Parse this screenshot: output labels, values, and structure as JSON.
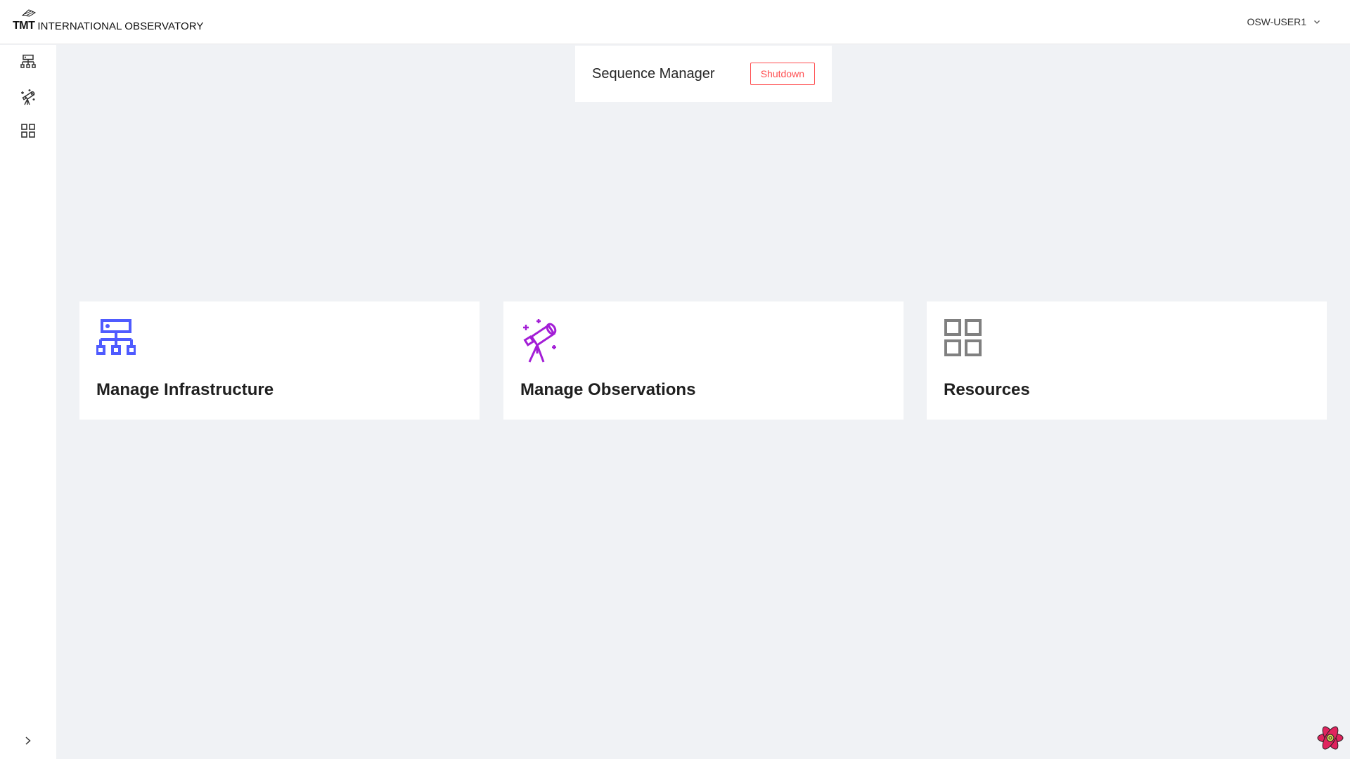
{
  "header": {
    "logo_mark": "TMT",
    "logo_text": "INTERNATIONAL OBSERVATORY",
    "user": "OSW-USER1"
  },
  "sidebar": {
    "items": [
      {
        "icon": "infrastructure-icon"
      },
      {
        "icon": "telescope-icon"
      },
      {
        "icon": "resources-grid-icon"
      }
    ],
    "collapse_icon": "chevron-right-icon"
  },
  "sequence_manager": {
    "title": "Sequence Manager",
    "shutdown_label": "Shutdown"
  },
  "tiles": [
    {
      "label": "Manage Infrastructure",
      "icon": "infrastructure-icon",
      "color": "#4f5bff"
    },
    {
      "label": "Manage Observations",
      "icon": "telescope-icon",
      "color": "#a31ed6"
    },
    {
      "label": "Resources",
      "icon": "resources-grid-icon",
      "color": "#808080"
    }
  ],
  "colors": {
    "background": "#f0f2f5",
    "danger": "#ff4d4f"
  }
}
